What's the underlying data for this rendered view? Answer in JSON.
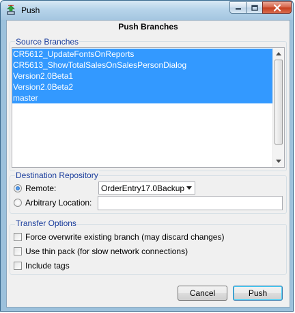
{
  "window": {
    "title": "Push",
    "icon": "git-push-app-icon",
    "controls": [
      "minimize-icon",
      "maximize-icon",
      "close-icon"
    ]
  },
  "dialog": {
    "heading": "Push Branches"
  },
  "source_branches": {
    "label": "Source Branches",
    "items": [
      {
        "label": "CR5612_UpdateFontsOnReports",
        "selected": true
      },
      {
        "label": "CR5613_ShowTotalSalesOnSalesPersonDialog",
        "selected": true
      },
      {
        "label": "Version2.0Beta1",
        "selected": true
      },
      {
        "label": "Version2.0Beta2",
        "selected": true
      },
      {
        "label": "master",
        "selected": true
      }
    ]
  },
  "destination": {
    "label": "Destination Repository",
    "remote_label": "Remote:",
    "remote_selected": true,
    "remote_value": "OrderEntry17.0Backup",
    "arbitrary_label": "Arbitrary Location:",
    "arbitrary_selected": false,
    "arbitrary_value": ""
  },
  "transfer": {
    "label": "Transfer Options",
    "options": [
      {
        "label": "Force overwrite existing branch (may discard changes)",
        "checked": false
      },
      {
        "label": "Use thin pack (for slow network connections)",
        "checked": false
      },
      {
        "label": "Include tags",
        "checked": false
      }
    ]
  },
  "buttons": {
    "cancel": "Cancel",
    "push": "Push"
  },
  "colors": {
    "selection": "#3399ff",
    "group_label": "#1a3d9c",
    "dialog_bg": "#f0f0f0"
  }
}
